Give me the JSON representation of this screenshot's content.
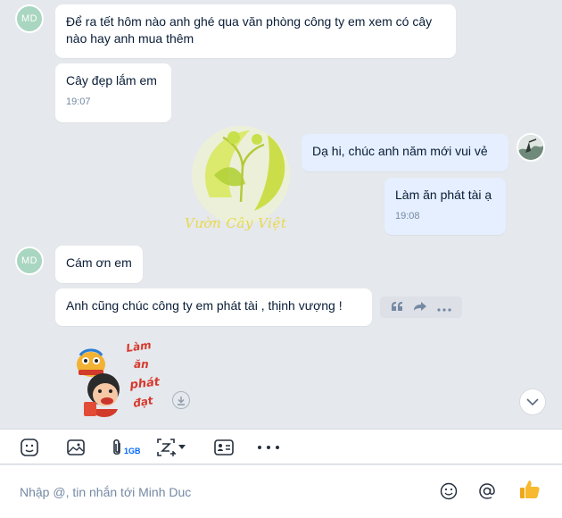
{
  "contact": {
    "avatar_initials": "MD"
  },
  "messages": [
    {
      "text": "Để ra tết hôm nào anh ghé qua văn phòng công ty em xem có cây nào hay anh mua thêm"
    },
    {
      "text": "Cây đẹp lắm em",
      "time": "19:07"
    },
    {
      "text": "Dạ hi, chúc anh năm mới vui vẻ"
    },
    {
      "text": "Làm ăn phát tài ạ",
      "time": "19:08"
    },
    {
      "text": "Cám ơn em"
    },
    {
      "text": "Anh cũng chúc công ty em phát tài , thịnh vượng !"
    }
  ],
  "watermark": {
    "text": "Vườn Cây Việt"
  },
  "sticker": {
    "lines": [
      "Làm",
      "ăn",
      "phát",
      "đạt"
    ]
  },
  "toolbar": {
    "file_size_label": "1GB"
  },
  "composer": {
    "placeholder": "Nhập @, tin nhắn tới Minh Duc"
  },
  "colors": {
    "accent": "#0068ff",
    "my_bubble": "#e5efff",
    "their_bubble": "#ffffff",
    "avatar_bg": "#a9d6c0"
  }
}
